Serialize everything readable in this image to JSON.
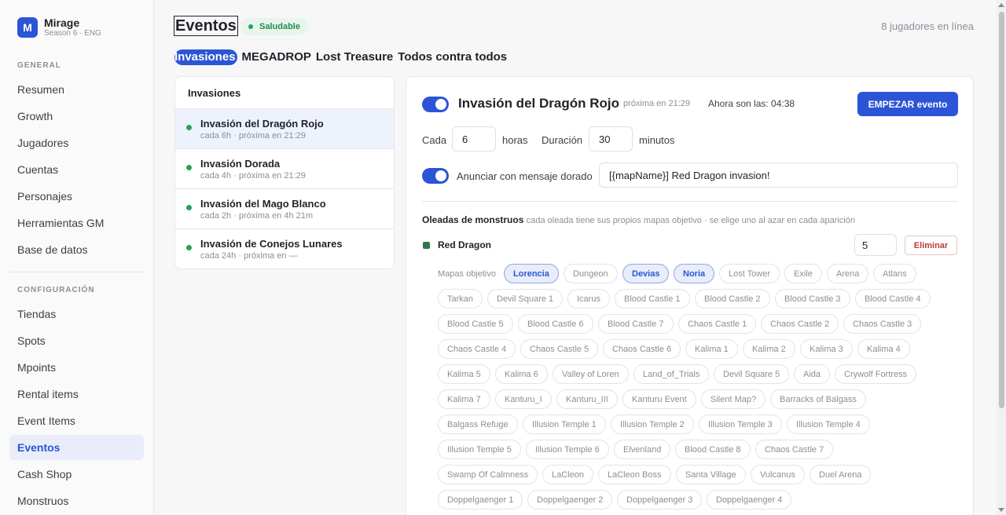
{
  "brand": {
    "logo": "M",
    "name": "Mirage",
    "sub": "Season 6 · ENG"
  },
  "sidebar": {
    "general_label": "GENERAL",
    "general_items": [
      "Resumen",
      "Growth",
      "Jugadores",
      "Cuentas",
      "Personajes",
      "Herramientas GM",
      "Base de datos"
    ],
    "config_label": "CONFIGURACIÓN",
    "config_items": [
      "Tiendas",
      "Spots",
      "Mpoints",
      "Rental items",
      "Event Items",
      "Eventos",
      "Cash Shop",
      "Monstruos"
    ],
    "active": "Eventos"
  },
  "header": {
    "title": "Eventos",
    "status": "Saludable",
    "online": "8 jugadores en línea"
  },
  "tabs": [
    "Invasiones",
    "MEGADROP",
    "Lost Treasure",
    "Todos contra todos"
  ],
  "list": {
    "header": "Invasiones",
    "items": [
      {
        "title": "Invasión del Dragón Rojo",
        "sub": "cada 6h · próxima en 21:29"
      },
      {
        "title": "Invasión Dorada",
        "sub": "cada 4h · próxima en 21:29"
      },
      {
        "title": "Invasión del Mago Blanco",
        "sub": "cada 2h · próxima en 4h 21m"
      },
      {
        "title": "Invasión de Conejos Lunares",
        "sub": "cada 24h · próxima en —"
      }
    ]
  },
  "detail": {
    "title": "Invasión del Dragón Rojo",
    "next": "próxima en 21:29",
    "now": "Ahora son las: 04:38",
    "start_button": "EMPEZAR evento",
    "every_label": "Cada",
    "every_value": "6",
    "hours_label": "horas",
    "duration_label": "Duración",
    "duration_value": "30",
    "minutes_label": "minutos",
    "announce_label": "Anunciar con mensaje dorado",
    "announce_value": "[{mapName}] Red Dragon invasion!",
    "waves_title": "Oleadas de monstruos",
    "waves_hint": "cada oleada tiene sus propios mapas objetivo · se elige uno al azar en cada aparición",
    "monster_name": "Red Dragon",
    "monster_count": "5",
    "delete_button": "Eliminar",
    "maps_label": "Mapas objetivo",
    "maps": [
      [
        "Lorencia",
        "Dungeon",
        "Devias",
        "Noria",
        "Lost Tower",
        "Exile",
        "Arena",
        "Atlans"
      ],
      [
        "Tarkan",
        "Devil Square 1",
        "Icarus",
        "Blood Castle 1",
        "Blood Castle 2",
        "Blood Castle 3",
        "Blood Castle 4"
      ],
      [
        "Blood Castle 5",
        "Blood Castle 6",
        "Blood Castle 7",
        "Chaos Castle 1",
        "Chaos Castle 2",
        "Chaos Castle 3"
      ],
      [
        "Chaos Castle 4",
        "Chaos Castle 5",
        "Chaos Castle 6",
        "Kalima 1",
        "Kalima 2",
        "Kalima 3",
        "Kalima 4"
      ],
      [
        "Kalima 5",
        "Kalima 6",
        "Valley of Loren",
        "Land_of_Trials",
        "Devil Square 5",
        "Aida",
        "Crywolf Fortress"
      ],
      [
        "Kalima 7",
        "Kanturu_I",
        "Kanturu_III",
        "Kanturu Event",
        "Silent Map?",
        "Barracks of Balgass"
      ],
      [
        "Balgass Refuge",
        "Illusion Temple 1",
        "Illusion Temple 2",
        "Illusion Temple 3",
        "Illusion Temple 4"
      ],
      [
        "Illusion Temple 5",
        "Illusion Temple 6",
        "Elvenland",
        "Blood Castle 8",
        "Chaos Castle 7"
      ],
      [
        "Swamp Of Calmness",
        "LaCleon",
        "LaCleon Boss",
        "Santa Village",
        "Vulcanus",
        "Duel Arena"
      ],
      [
        "Doppelgaenger 1",
        "Doppelgaenger 2",
        "Doppelgaenger 3",
        "Doppelgaenger 4"
      ]
    ],
    "selected_maps": [
      "Lorencia",
      "Devias",
      "Noria"
    ]
  }
}
